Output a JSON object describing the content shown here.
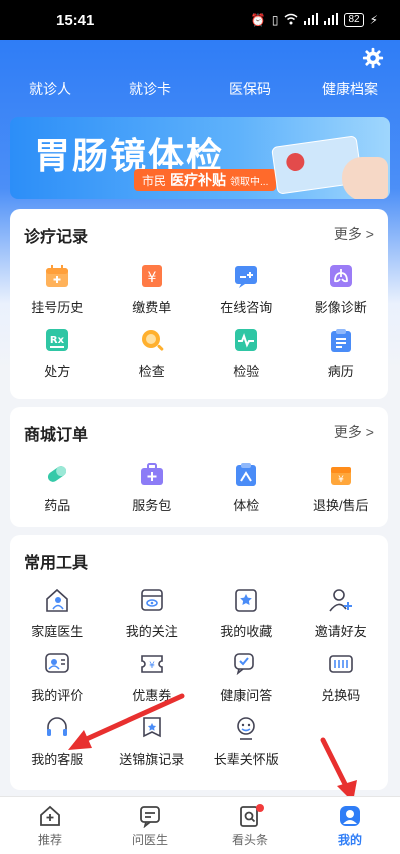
{
  "status_bar": {
    "time": "15:41",
    "battery": "82"
  },
  "top_nav": [
    "就诊人",
    "就诊卡",
    "医保码",
    "健康档案"
  ],
  "banner": {
    "title": "胃肠镜体检",
    "pill_prefix": "市民",
    "pill_highlight": "医疗补贴",
    "pill_suffix": "领取中..."
  },
  "medical_records": {
    "title": "诊疗记录",
    "more": "更多 >",
    "items": [
      {
        "label": "挂号历史",
        "icon": "calendar-icon",
        "color": "#ff9f3a"
      },
      {
        "label": "缴费单",
        "icon": "yuan-icon",
        "color": "#ff7a45"
      },
      {
        "label": "在线咨询",
        "icon": "chat-plus-icon",
        "color": "#4a8cf7"
      },
      {
        "label": "影像诊断",
        "icon": "lung-icon",
        "color": "#9b7cf6"
      },
      {
        "label": "处方",
        "icon": "rx-icon",
        "color": "#2fc6a4"
      },
      {
        "label": "检查",
        "icon": "magnifier-icon",
        "color": "#ffb02e"
      },
      {
        "label": "检验",
        "icon": "pulse-icon",
        "color": "#2fc6a4"
      },
      {
        "label": "病历",
        "icon": "clipboard-icon",
        "color": "#4a8cf7"
      }
    ]
  },
  "mall_orders": {
    "title": "商城订单",
    "more": "更多 >",
    "items": [
      {
        "label": "药品",
        "icon": "pill-icon",
        "color": "#36c9a8"
      },
      {
        "label": "服务包",
        "icon": "service-pack-icon",
        "color": "#8c7cf6"
      },
      {
        "label": "体检",
        "icon": "checkup-icon",
        "color": "#4a8cf7"
      },
      {
        "label": "退换/售后",
        "icon": "return-box-icon",
        "color": "#ffa63a"
      }
    ]
  },
  "tools": {
    "title": "常用工具",
    "items": [
      {
        "label": "家庭医生",
        "icon": "family-doctor-icon"
      },
      {
        "label": "我的关注",
        "icon": "follow-icon"
      },
      {
        "label": "我的收藏",
        "icon": "bookmark-star-icon"
      },
      {
        "label": "邀请好友",
        "icon": "invite-friend-icon"
      },
      {
        "label": "我的评价",
        "icon": "review-icon"
      },
      {
        "label": "优惠券",
        "icon": "coupon-icon"
      },
      {
        "label": "健康问答",
        "icon": "qa-icon"
      },
      {
        "label": "兑换码",
        "icon": "redeem-code-icon"
      },
      {
        "label": "我的客服",
        "icon": "headset-icon"
      },
      {
        "label": "送锦旗记录",
        "icon": "banner-flag-icon"
      },
      {
        "label": "长辈关怀版",
        "icon": "elder-care-icon"
      }
    ]
  },
  "bottom_tabs": [
    {
      "label": "推荐",
      "icon": "home-plus-icon",
      "active": false
    },
    {
      "label": "问医生",
      "icon": "chat-doctor-icon",
      "active": false
    },
    {
      "label": "看头条",
      "icon": "news-search-icon",
      "active": false,
      "badge": true
    },
    {
      "label": "我的",
      "icon": "user-icon",
      "active": true
    }
  ],
  "colors": {
    "primary": "#2f7df6",
    "accent_orange": "#ff6a2b",
    "arrow_red": "#e8302f"
  }
}
